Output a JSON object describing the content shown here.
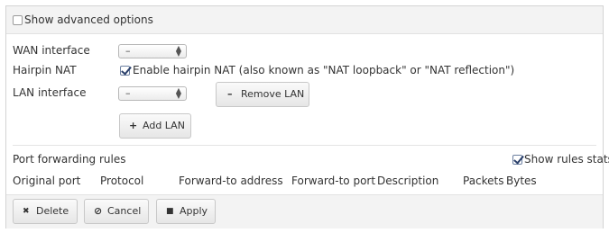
{
  "advanced": {
    "label": "Show advanced options",
    "checked": false
  },
  "wan": {
    "label": "WAN interface",
    "value": "–"
  },
  "hairpin": {
    "label": "Hairpin NAT",
    "checkbox_label": "Enable hairpin NAT (also known as \"NAT loopback\" or \"NAT reflection\")",
    "checked": true
  },
  "lan": {
    "label": "LAN interface",
    "value": "–",
    "remove_icon": "–",
    "remove_label": "Remove LAN",
    "add_icon": "+",
    "add_label": "Add LAN"
  },
  "port_forwarding": {
    "title": "Port forwarding rules",
    "show_stats_label": "Show rules stats",
    "show_stats_checked": true,
    "columns": [
      "Original port",
      "Protocol",
      "Forward-to address",
      "Forward-to port",
      "Description",
      "Packets",
      "Bytes"
    ]
  },
  "footer": {
    "delete_icon": "✖",
    "delete_label": "Delete",
    "cancel_icon": "⊘",
    "cancel_label": "Cancel",
    "apply_icon": "■",
    "apply_label": "Apply"
  },
  "icons": {
    "select_arrows": "select-arrows-icon",
    "remove": "minus-icon",
    "add": "plus-icon",
    "delete": "x-icon",
    "cancel": "cancel-circle-icon",
    "apply": "save-icon"
  }
}
